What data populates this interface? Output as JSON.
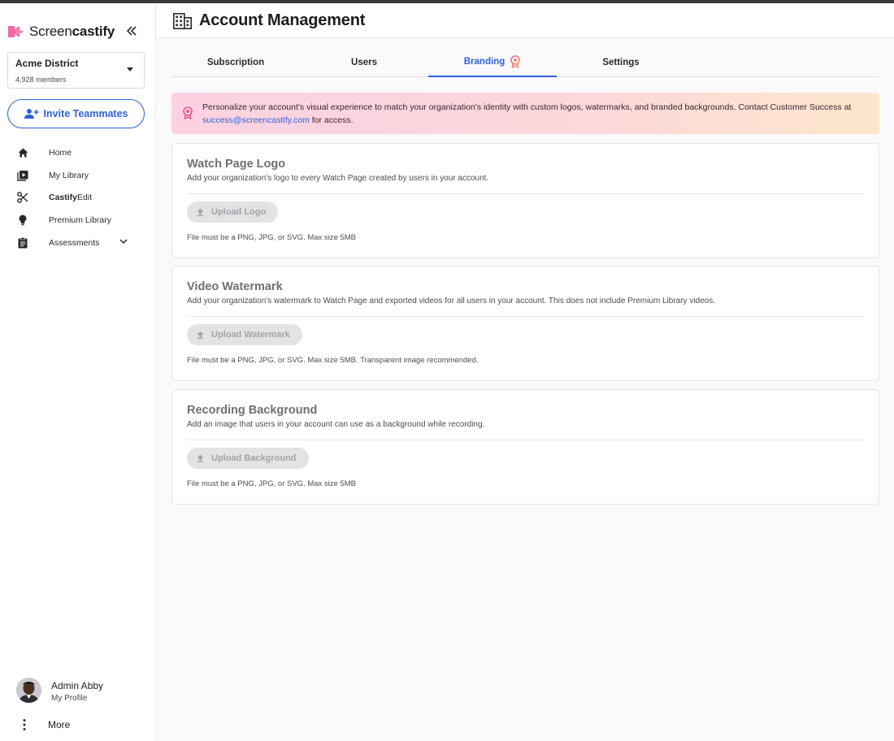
{
  "brand": {
    "name_light": "Screen",
    "name_bold": "castify",
    "accent": "#f06aa3"
  },
  "sidebar": {
    "district": {
      "name": "Acme District",
      "members": "4,928 members"
    },
    "invite_label": "Invite Teammates",
    "items": [
      {
        "label": "Home",
        "icon": "home-icon"
      },
      {
        "label": "My Library",
        "icon": "video-library-icon"
      },
      {
        "label_bold": "Castify",
        "label_rest": "Edit",
        "icon": "scissors-icon"
      },
      {
        "label": "Premium Library",
        "icon": "lightbulb-icon"
      },
      {
        "label": "Assessments",
        "icon": "clipboard-icon"
      }
    ],
    "profile": {
      "name": "Admin Abby",
      "sub": "My Profile"
    },
    "more_label": "More"
  },
  "header": {
    "title": "Account Management"
  },
  "tabs": [
    {
      "label": "Subscription"
    },
    {
      "label": "Users"
    },
    {
      "label": "Branding",
      "active": true
    },
    {
      "label": "Settings"
    }
  ],
  "banner": {
    "text_before": "Personalize your account's visual experience to match your organization's identity with custom logos, watermarks, and branded backgrounds. Contact Customer Success at ",
    "email": "success@screencastify.com",
    "text_after": " for access."
  },
  "cards": [
    {
      "title": "Watch Page Logo",
      "description": "Add your organization's logo to every Watch Page created by users in your account.",
      "button": "Upload Logo",
      "hint": "File must be a PNG, JPG, or SVG. Max size 5MB"
    },
    {
      "title": "Video Watermark",
      "description": "Add your organization's watermark to Watch Page and exported videos for all users in your account. This does not include Premium Library videos.",
      "button": "Upload Watermark",
      "hint": "File must be a PNG, JPG, or SVG. Max size 5MB. Transparent image recommended."
    },
    {
      "title": "Recording Background",
      "description": "Add an image that users in your account can use as a background while recording.",
      "button": "Upload Background",
      "hint": "File must be a PNG, JPG, or SVG. Max size 5MB"
    }
  ],
  "colors": {
    "primary": "#2f62d9",
    "disabled_text": "#a3a3a8",
    "banner_start": "#fcd2e2",
    "banner_end": "#fde7cc"
  }
}
